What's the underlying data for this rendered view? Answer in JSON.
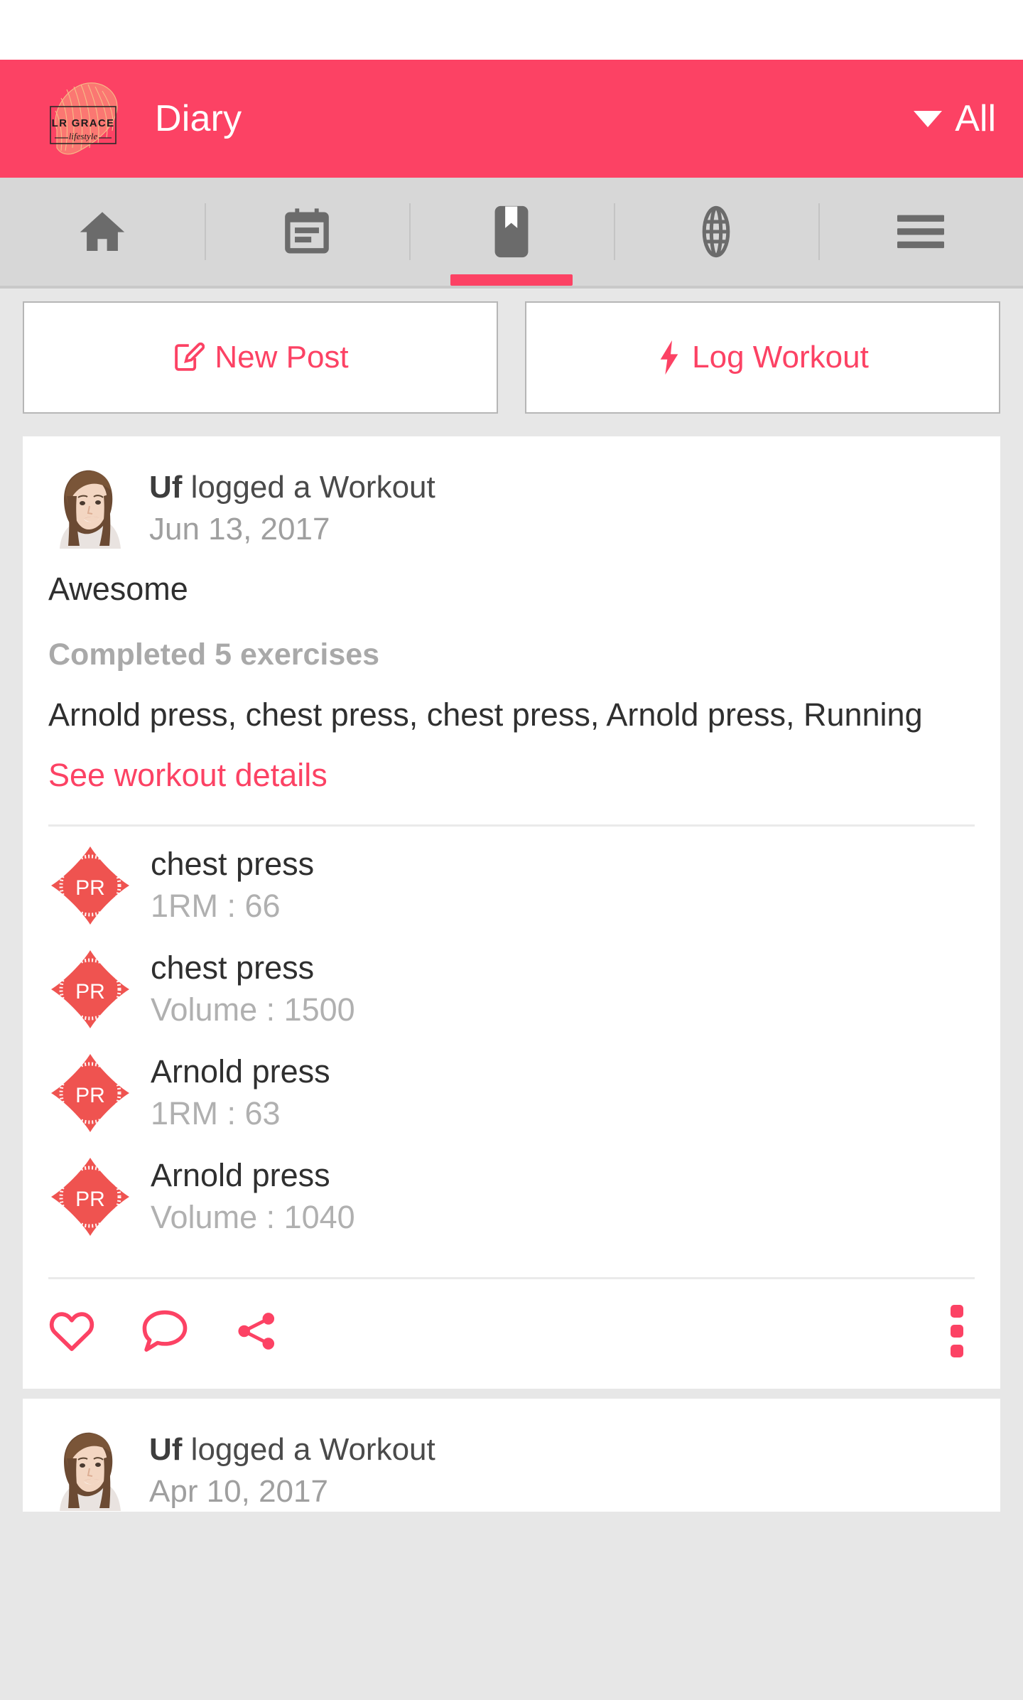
{
  "appbar": {
    "title": "Diary",
    "logo_line1": "LR GRACE",
    "logo_line2": "lifestyle",
    "filter_label": "All",
    "caret_icon": "chevron-down-icon",
    "background_color": "#fc4264"
  },
  "tabs": [
    {
      "icon": "home-icon",
      "label": "Home",
      "active": false
    },
    {
      "icon": "calendar-icon",
      "label": "Calendar",
      "active": false
    },
    {
      "icon": "bookmark-icon",
      "label": "Diary",
      "active": true
    },
    {
      "icon": "globe-icon",
      "label": "Explore",
      "active": false
    },
    {
      "icon": "hamburger-menu-icon",
      "label": "More",
      "active": false
    }
  ],
  "actions": {
    "new_post": {
      "label": "New Post",
      "icon": "edit-square-icon"
    },
    "log_workout": {
      "label": "Log Workout",
      "icon": "lightning-bolt-icon"
    }
  },
  "posts": [
    {
      "author": "Uf",
      "action_text": " logged a Workout",
      "date": "Jun 13, 2017",
      "text": "Awesome",
      "summary": "Completed 5 exercises",
      "exercises": "Arnold press, chest press, chest press, Arnold press, Running",
      "details_link": "See workout details",
      "records": [
        {
          "badge": "PR",
          "title": "chest press",
          "metric": "1RM : 66"
        },
        {
          "badge": "PR",
          "title": "chest press",
          "metric": "Volume : 1500"
        },
        {
          "badge": "PR",
          "title": "Arnold press",
          "metric": "1RM : 63"
        },
        {
          "badge": "PR",
          "title": "Arnold press",
          "metric": "Volume : 1040"
        }
      ],
      "footer_icons": [
        "heart-icon",
        "comment-icon",
        "share-icon",
        "more-vertical-icon"
      ]
    },
    {
      "author": "Uf",
      "action_text": " logged a Workout",
      "date": "Apr 10, 2017"
    }
  ],
  "colors": {
    "accent": "#fc4264",
    "badge": "#ef5350",
    "tabbar": "#d7d7d7",
    "page_bg": "#e7e7e7",
    "muted_text": "#a9a9a9"
  }
}
